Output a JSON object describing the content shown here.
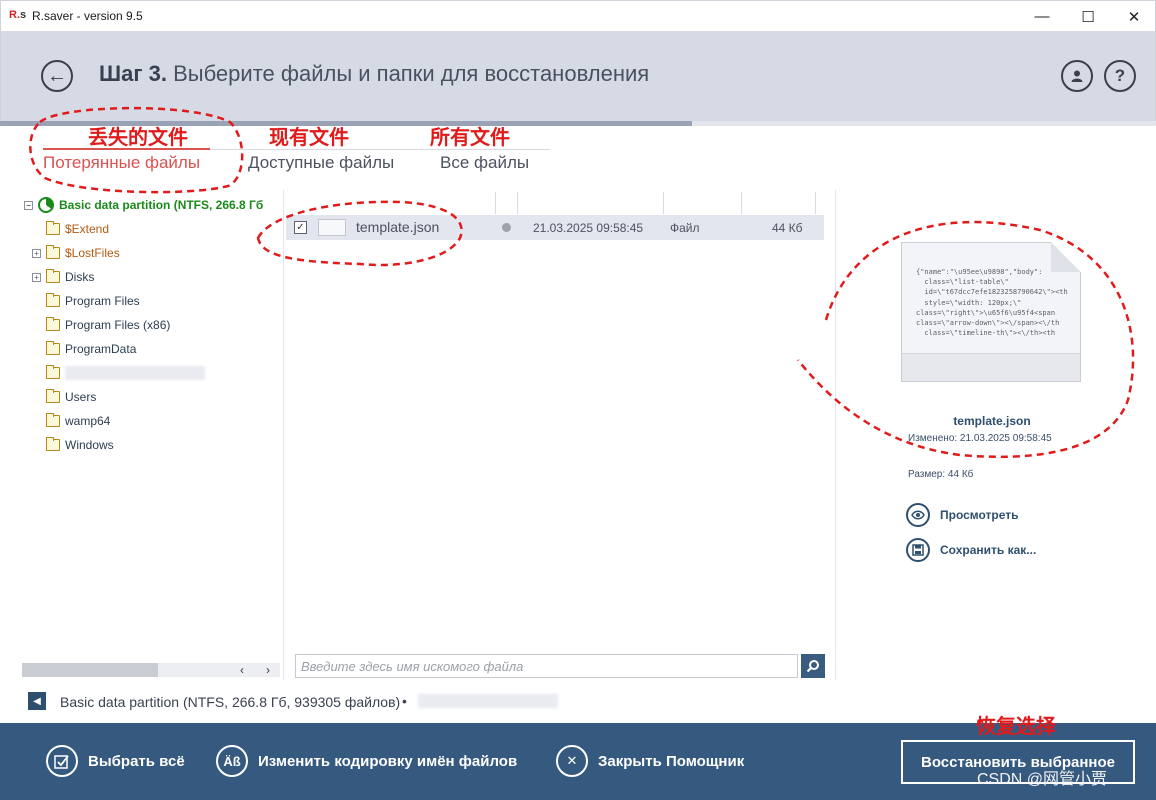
{
  "window": {
    "logo_main": "R.",
    "logo_sub": "s",
    "title": "R.saver - version 9.5",
    "minimize_glyph": "—",
    "maximize_glyph": "☐",
    "close_glyph": "✕"
  },
  "header": {
    "step_label": "Шаг 3.",
    "step_text": "Выберите файлы и папки для восстановления",
    "user_icon": "user-icon",
    "help_label": "?"
  },
  "tabs": [
    {
      "label": "Потерянные файлы",
      "annotation": "丢失的文件",
      "active": true
    },
    {
      "label": "Доступные файлы",
      "annotation": "现有文件",
      "active": false
    },
    {
      "label": "Все файлы",
      "annotation": "所有文件",
      "active": false
    }
  ],
  "tree": {
    "root": "Basic data partition (NTFS, 266.8 Гб",
    "items": [
      {
        "label": "$Extend",
        "expandable": false,
        "lost": true
      },
      {
        "label": "$LostFiles",
        "expandable": true,
        "lost": true
      },
      {
        "label": "Disks",
        "expandable": true,
        "lost": false
      },
      {
        "label": "Program Files",
        "expandable": false,
        "lost": false
      },
      {
        "label": "Program Files (x86)",
        "expandable": false,
        "lost": false
      },
      {
        "label": "ProgramData",
        "expandable": false,
        "lost": false
      },
      {
        "label": "",
        "expandable": false,
        "lost": false,
        "blurred": true
      },
      {
        "label": "Users",
        "expandable": false,
        "lost": false
      },
      {
        "label": "wamp64",
        "expandable": false,
        "lost": false
      },
      {
        "label": "Windows",
        "expandable": false,
        "lost": false
      }
    ]
  },
  "files": [
    {
      "checked": true,
      "name": "template.json",
      "date": "21.03.2025 09:58:45",
      "type": "Файл",
      "size": "44 Кб"
    }
  ],
  "search": {
    "placeholder": "Введите здесь имя искомого файла"
  },
  "preview": {
    "code": "{\"name\":\"\\u95ee\\u9898\",\"body\":\n  class=\\\"list-table\\\"\n  id=\\\"t67dcc7efe1823258790642\\\"><th\n  style=\\\"width: 120px;\\\"\nclass=\\\"right\\\">\\u65f6\\u95f4<span\nclass=\\\"arrow-down\\\"><\\/span><\\/th\n  class=\\\"timeline-th\\\"><\\/th><th",
    "name": "template.json",
    "modified": "Изменено: 21.03.2025 09:58:45",
    "size": "Размер: 44 Кб",
    "view_label": "Просмотреть",
    "save_label": "Сохранить как..."
  },
  "status": {
    "text": "Basic data partition (NTFS, 266.8 Гб, 939305 файлов)",
    "bullet": "•"
  },
  "bottom": {
    "select_all": "Выбрать всё",
    "change_encoding": "Изменить кодировку имён файлов",
    "encoding_icon_text": "Äß",
    "close_wizard": "Закрыть Помощник",
    "restore": "Восстановить выбранное",
    "restore_annotation": "恢复选择"
  },
  "watermark": "CSDN @网管小贾",
  "colors": {
    "header_bg": "#d6dae5",
    "bottom_bg": "#35597f",
    "active_tab": "#d9534f",
    "annotation": "#e11b1b",
    "tree_root": "#1a8a1a"
  }
}
